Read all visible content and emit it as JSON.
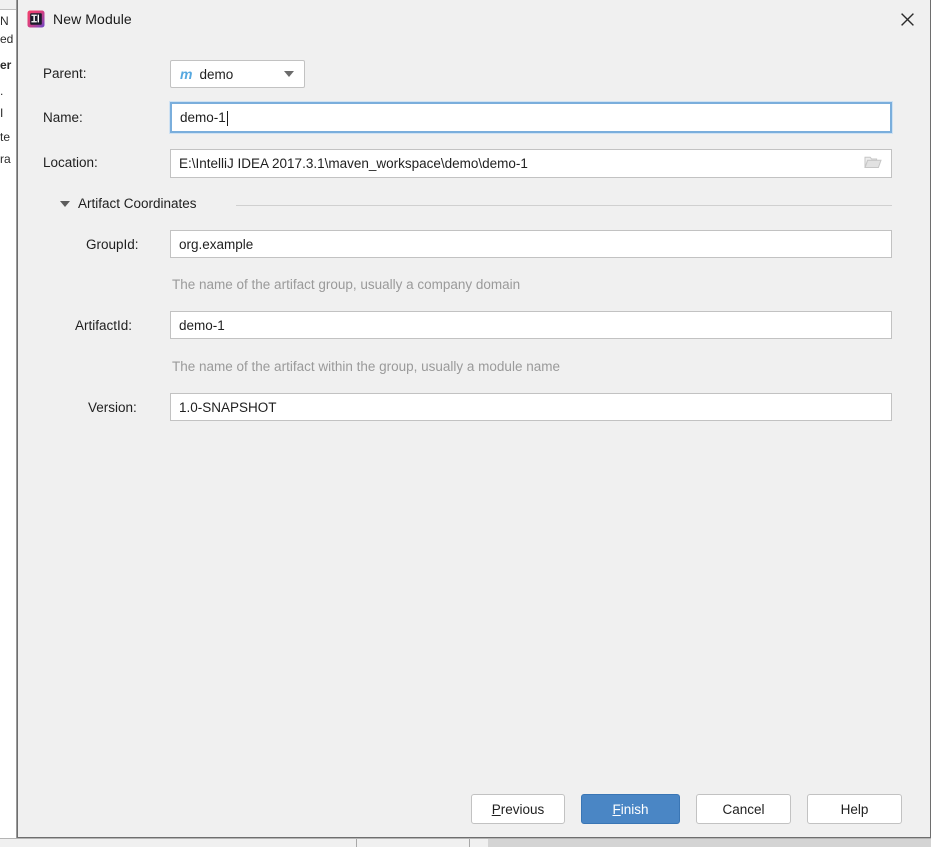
{
  "window": {
    "title": "New Module",
    "icon": "intellij-idea-icon",
    "close_label": "✕"
  },
  "form": {
    "parent": {
      "label": "Parent:",
      "icon": "maven-module-icon",
      "icon_glyph": "m",
      "value": "demo",
      "arrow": "chevron-down-icon"
    },
    "name": {
      "label": "Name:",
      "value": "demo-1",
      "focused": true
    },
    "location": {
      "label": "Location:",
      "value": "E:\\IntelliJ IDEA 2017.3.1\\maven_workspace\\demo\\demo-1",
      "browse_icon": "folder-icon"
    }
  },
  "artifact_section": {
    "title": "Artifact Coordinates",
    "expanded": true,
    "toggle_icon": "triangle-down-icon",
    "fields": [
      {
        "label": "GroupId:",
        "value": "org.example",
        "hint": "The name of the artifact group, usually a company domain"
      },
      {
        "label": "ArtifactId:",
        "value": "demo-1",
        "hint": "The name of the artifact within the group, usually a module name"
      },
      {
        "label": "Version:",
        "value": "1.0-SNAPSHOT",
        "hint": ""
      }
    ]
  },
  "footer": {
    "buttons": [
      {
        "name": "previous",
        "label": "Previous",
        "mnemonic": "P",
        "default": false
      },
      {
        "name": "finish",
        "label": "Finish",
        "mnemonic": "F",
        "default": true
      },
      {
        "name": "cancel",
        "label": "Cancel",
        "mnemonic": "",
        "default": false
      },
      {
        "name": "help",
        "label": "Help",
        "mnemonic": "",
        "default": false
      }
    ]
  },
  "background": {
    "left_fragments": [
      "N",
      "ed",
      "er",
      ".",
      "I",
      "te",
      "ra"
    ],
    "right_accent_color": "#6c9fd2"
  },
  "colors": {
    "dialog_bg": "#f0f0f0",
    "field_bg": "#ffffff",
    "border": "#c2c2c2",
    "focus_border": "#7aaedc",
    "accent": "#4a86c5",
    "maven_icon": "#56a8e0",
    "hint_text": "#9a9a9a",
    "text": "#1f1f1f"
  }
}
